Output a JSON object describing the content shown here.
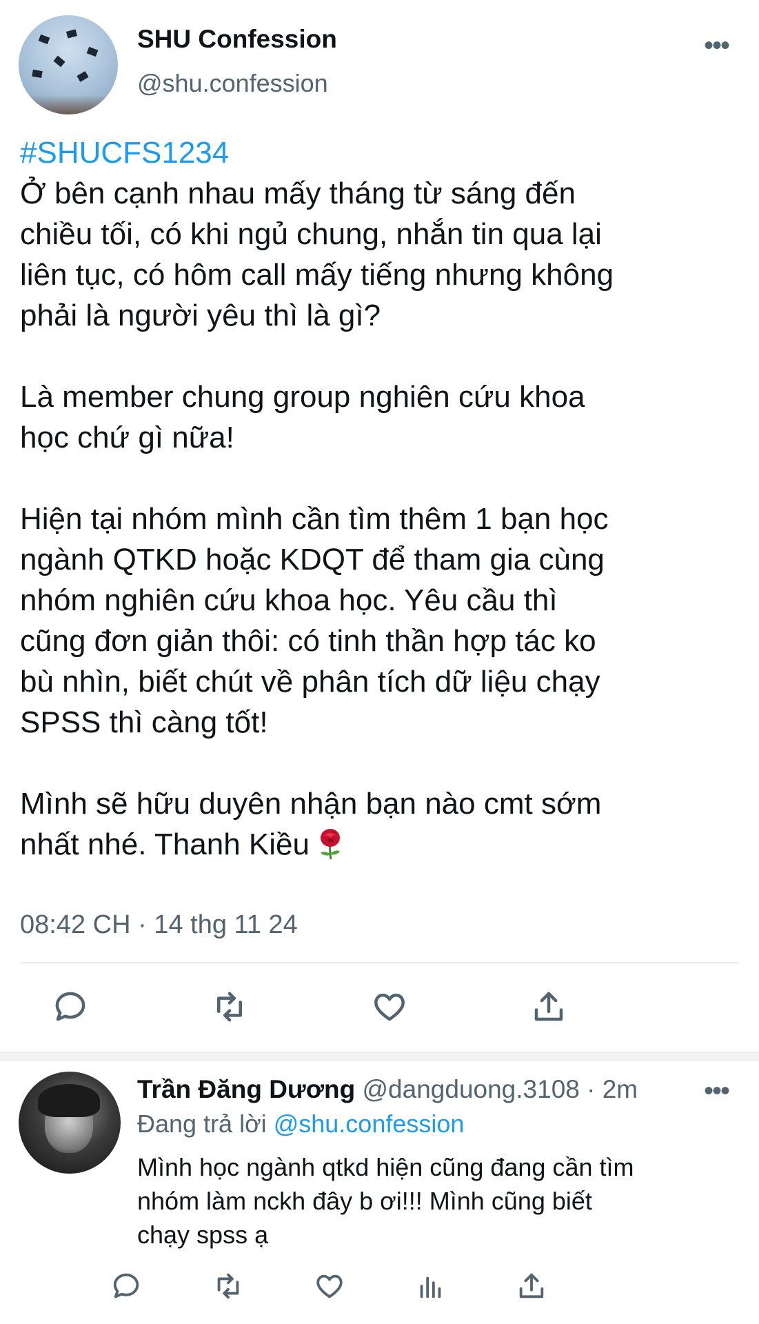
{
  "tweet": {
    "author_name": "SHU Confession",
    "author_handle": "@shu.confession",
    "more_icon": "more-horizontal-icon",
    "hashtag": "#SHUCFS1234",
    "paragraphs": [
      "Ở bên cạnh nhau mấy tháng từ sáng đến\nchiều tối, có khi ngủ chung, nhắn tin qua lại\nliên tục, có hôm call mấy tiếng nhưng không\nphải là người yêu thì là gì?",
      "Là member chung group nghiên cứu khoa\nhọc chứ gì nữa!",
      "Hiện tại nhóm mình cần tìm thêm 1 bạn học\nngành QTKD hoặc KDQT để tham gia cùng\nnhóm nghiên cứu khoa học. Yêu cầu thì\ncũng đơn giản thôi: có tinh thần hợp tác ko\nbù nhìn, biết chút về phân tích dữ liệu chạy\nSPSS thì càng tốt!",
      "Mình sẽ hữu duyên nhận bạn nào cmt sớm\nnhất nhé. Thanh Kiều"
    ],
    "emoji": "rose-emoji",
    "timestamp": "08:42 CH · 14 thg 11 24",
    "actions": [
      "reply-icon",
      "retweet-icon",
      "like-icon",
      "share-icon"
    ]
  },
  "reply": {
    "name": "Trần Đăng Dương",
    "meta": "@dangduong.3108 · 2m",
    "replying_prefix": "Đang trả lời",
    "replying_to": "@shu.confession",
    "text": "Mình học ngành qtkd hiện cũng đang cần tìm\nnhóm làm nckh đây b ơi!!! Mình cũng biết\nchạy spss ạ",
    "actions": [
      "reply-icon",
      "retweet-icon",
      "like-icon",
      "analytics-icon",
      "share-icon"
    ]
  },
  "colors": {
    "text": "#0f1419",
    "secondary": "#536471",
    "accent": "#1d9bf0"
  }
}
